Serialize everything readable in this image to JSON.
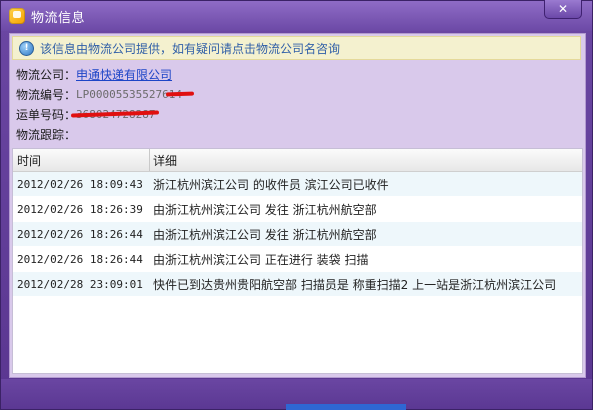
{
  "window": {
    "title": "物流信息",
    "close_label": "✕"
  },
  "notice": {
    "icon": "info-icon",
    "text": "该信息由物流公司提供，如有疑问请点击物流公司名咨询"
  },
  "info": {
    "company_label": "物流公司：",
    "company_value": "申通快递有限公司",
    "tracking_label": "物流编号：",
    "tracking_value": "LP00005535527614",
    "waybill_label": "运单号码：",
    "waybill_value": "368024728287",
    "trace_label": "物流跟踪："
  },
  "table": {
    "headers": [
      "时间",
      "详细"
    ],
    "rows": [
      {
        "time": "2012/02/26 18:09:43",
        "detail": "浙江杭州滨江公司 的收件员 滨江公司已收件"
      },
      {
        "time": "2012/02/26 18:26:39",
        "detail": "由浙江杭州滨江公司 发往 浙江杭州航空部"
      },
      {
        "time": "2012/02/26 18:26:44",
        "detail": "由浙江杭州滨江公司 发往 浙江杭州航空部"
      },
      {
        "time": "2012/02/26 18:26:44",
        "detail": "由浙江杭州滨江公司 正在进行 装袋 扫描"
      },
      {
        "time": "2012/02/28 23:09:01",
        "detail": "快件已到达贵州贵阳航空部 扫描员是 称重扫描2 上一站是浙江杭州滨江公司"
      }
    ]
  }
}
